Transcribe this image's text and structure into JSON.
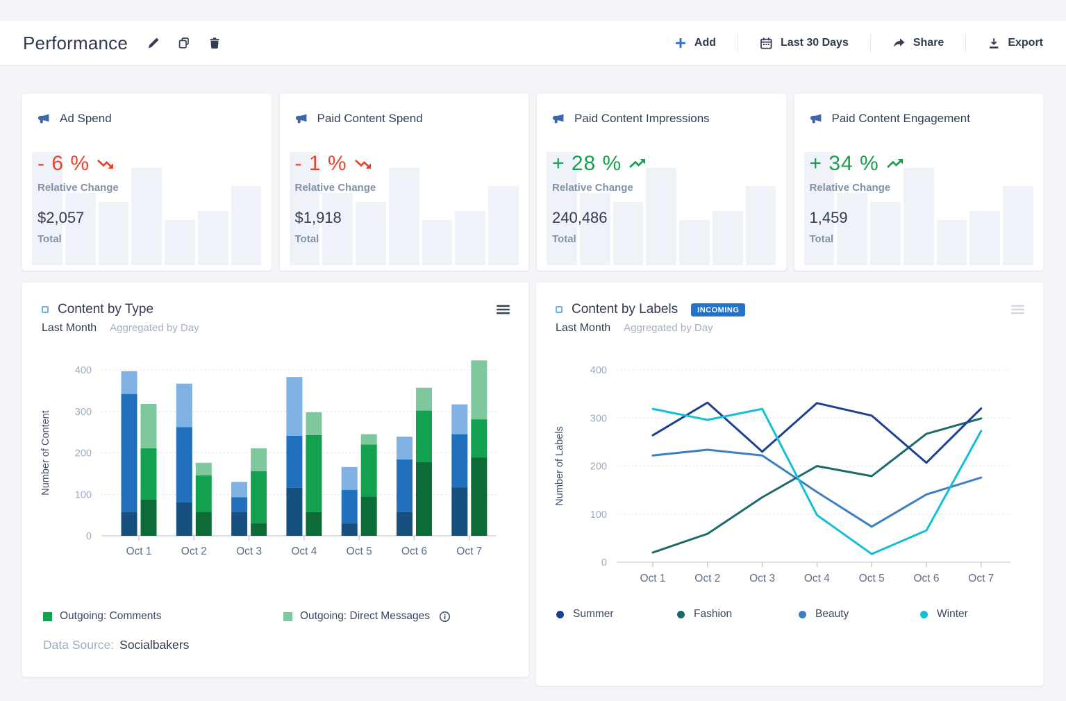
{
  "header": {
    "title": "Performance",
    "actions": {
      "add": "Add",
      "date_range": "Last 30 Days",
      "share": "Share",
      "export": "Export"
    }
  },
  "kpi_common": {
    "change_label": "Relative Change",
    "total_label": "Total"
  },
  "kpis": [
    {
      "title": "Ad Spend",
      "change": "- 6 %",
      "trend": "down",
      "total": "$2,057"
    },
    {
      "title": "Paid Content Spend",
      "change": "- 1 %",
      "trend": "down",
      "total": "$1,918"
    },
    {
      "title": "Paid Content Impressions",
      "change": "+ 28 %",
      "trend": "up",
      "total": "240,486"
    },
    {
      "title": "Paid Content Engagement",
      "change": "+ 34 %",
      "trend": "up",
      "total": "1,459"
    }
  ],
  "sparkline_heights_pct": [
    100,
    64,
    56,
    86,
    40,
    48,
    70
  ],
  "colors": {
    "positive": "#16a14c",
    "negative": "#e9432f",
    "accent_blue": "#2b6fd0",
    "icon_dark": "#333f51",
    "megaphone": "#3a68a9",
    "burger_dark": "#3a4656",
    "burger_light": "#d3d8e0",
    "badge_bg": "#2273c9"
  },
  "chart_data": [
    {
      "type": "bar",
      "title": "Content by Type",
      "subtitle": "Last Month",
      "subtitle_note": "Aggregated by Day",
      "ylabel": "Number of Content",
      "yticks": [
        0,
        100,
        200,
        300,
        400
      ],
      "categories": [
        "Oct 1",
        "Oct 2",
        "Oct 3",
        "Oct 4",
        "Oct 5",
        "Oct 6",
        "Oct 7"
      ],
      "grouped_stacks": [
        {
          "group": "blue",
          "segments": [
            {
              "id": "dark",
              "color": "#17507f",
              "values": [
                58,
                81,
                58,
                116,
                30,
                57,
                117
              ]
            },
            {
              "id": "mid",
              "color": "#2170bd",
              "values": [
                284,
                181,
                35,
                125,
                81,
                127,
                128
              ]
            },
            {
              "id": "light",
              "color": "#7fb1e2",
              "values": [
                55,
                105,
                37,
                142,
                55,
                55,
                72
              ]
            }
          ]
        },
        {
          "group": "green",
          "segments": [
            {
              "id": "dark",
              "color": "#0c6b37",
              "values": [
                87,
                58,
                30,
                57,
                95,
                178,
                189
              ]
            },
            {
              "id": "mid",
              "color": "#12a14f",
              "values": [
                124,
                88,
                126,
                186,
                125,
                124,
                92
              ]
            },
            {
              "id": "light",
              "color": "#7fc79d",
              "values": [
                107,
                30,
                55,
                55,
                25,
                55,
                142
              ]
            }
          ]
        }
      ],
      "legend": [
        {
          "label": "Outgoing: Comments",
          "color": "#12a14f",
          "info": false
        },
        {
          "label": "Outgoing: Direct Messages",
          "color": "#7fc79d",
          "info": true
        }
      ],
      "data_source_label": "Data Source:",
      "data_source": "Socialbakers"
    },
    {
      "type": "line",
      "title": "Content by Labels",
      "badge": "INCOMING",
      "subtitle": "Last Month",
      "subtitle_note": "Aggregated by Day",
      "ylabel": "Number of Labels",
      "yticks": [
        0,
        100,
        200,
        300,
        400
      ],
      "categories": [
        "Oct 1",
        "Oct 2",
        "Oct 3",
        "Oct 4",
        "Oct 5",
        "Oct 6",
        "Oct 7"
      ],
      "series": [
        {
          "name": "Summer",
          "color": "#1c4191",
          "values": [
            264,
            332,
            230,
            331,
            305,
            207,
            320
          ]
        },
        {
          "name": "Fashion",
          "color": "#1c6a6d",
          "values": [
            20,
            59,
            135,
            200,
            179,
            267,
            299
          ]
        },
        {
          "name": "Beauty",
          "color": "#3c80c2",
          "values": [
            222,
            234,
            222,
            146,
            74,
            141,
            176
          ]
        },
        {
          "name": "Winter",
          "color": "#14bed6",
          "values": [
            319,
            296,
            319,
            98,
            17,
            66,
            273
          ]
        }
      ]
    }
  ]
}
